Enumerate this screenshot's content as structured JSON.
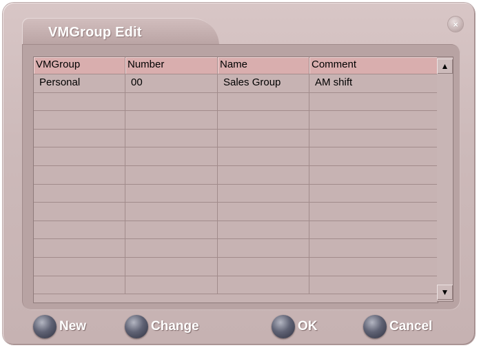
{
  "window": {
    "title": "VMGroup Edit",
    "close_glyph": "×"
  },
  "table": {
    "columns": [
      "VMGroup",
      "Number",
      "Name",
      "Comment"
    ],
    "rows": [
      [
        "Personal",
        "00",
        "Sales Group",
        "AM shift"
      ],
      [
        "",
        "",
        "",
        ""
      ],
      [
        "",
        "",
        "",
        ""
      ],
      [
        "",
        "",
        "",
        ""
      ],
      [
        "",
        "",
        "",
        ""
      ],
      [
        "",
        "",
        "",
        ""
      ],
      [
        "",
        "",
        "",
        ""
      ],
      [
        "",
        "",
        "",
        ""
      ],
      [
        "",
        "",
        "",
        ""
      ],
      [
        "",
        "",
        "",
        ""
      ],
      [
        "",
        "",
        "",
        ""
      ],
      [
        "",
        "",
        "",
        ""
      ]
    ]
  },
  "scrollbar": {
    "up_glyph": "▲",
    "down_glyph": "▼"
  },
  "buttons": {
    "new": "New",
    "change": "Change",
    "ok": "OK",
    "cancel": "Cancel"
  },
  "icons": {
    "close": "close-icon",
    "button_knob": "round-knob-icon",
    "scroll_up": "arrow-up-icon",
    "scroll_down": "arrow-down-icon"
  },
  "colors": {
    "dialog_bg": "#cdbaba",
    "header_bg": "#d9aeae",
    "button_knob": "#4a4d5e"
  }
}
